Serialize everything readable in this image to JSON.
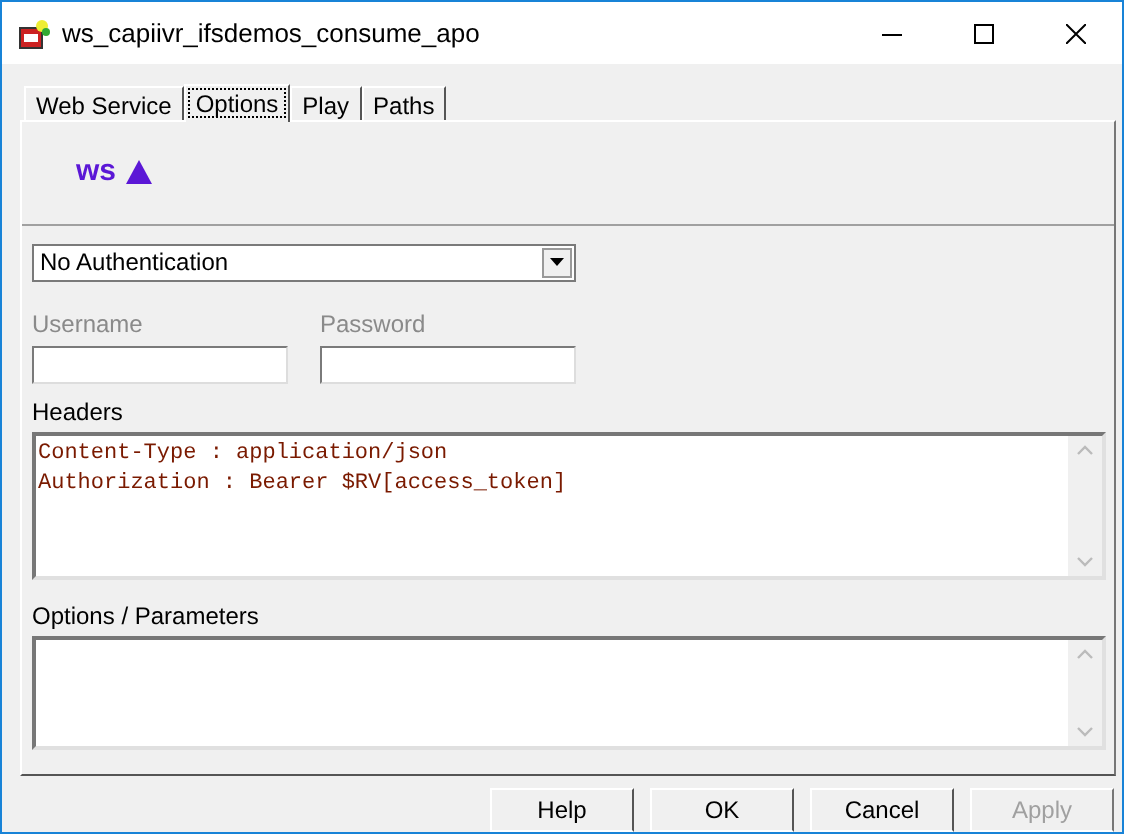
{
  "window": {
    "title": "ws_capiivr_ifsdemos_consume_apo"
  },
  "tabs": [
    {
      "label": "Web Service",
      "selected": false
    },
    {
      "label": "Options",
      "selected": true
    },
    {
      "label": "Play",
      "selected": false
    },
    {
      "label": "Paths",
      "selected": false
    }
  ],
  "logo": {
    "text": "ws"
  },
  "authentication": {
    "value": "No Authentication"
  },
  "credentials": [
    {
      "label": "Username",
      "disabled": true
    },
    {
      "label": "Password",
      "disabled": true
    }
  ],
  "headers": {
    "label": "Headers",
    "lines": [
      "Content-Type : application/json",
      "Authorization : Bearer $RV[access_token]"
    ]
  },
  "options": {
    "label": "Options / Parameters"
  },
  "buttons": [
    {
      "label": "Help",
      "disabled": false
    },
    {
      "label": "OK",
      "disabled": false
    },
    {
      "label": "Cancel",
      "disabled": false
    },
    {
      "label": "Apply",
      "disabled": true
    }
  ]
}
